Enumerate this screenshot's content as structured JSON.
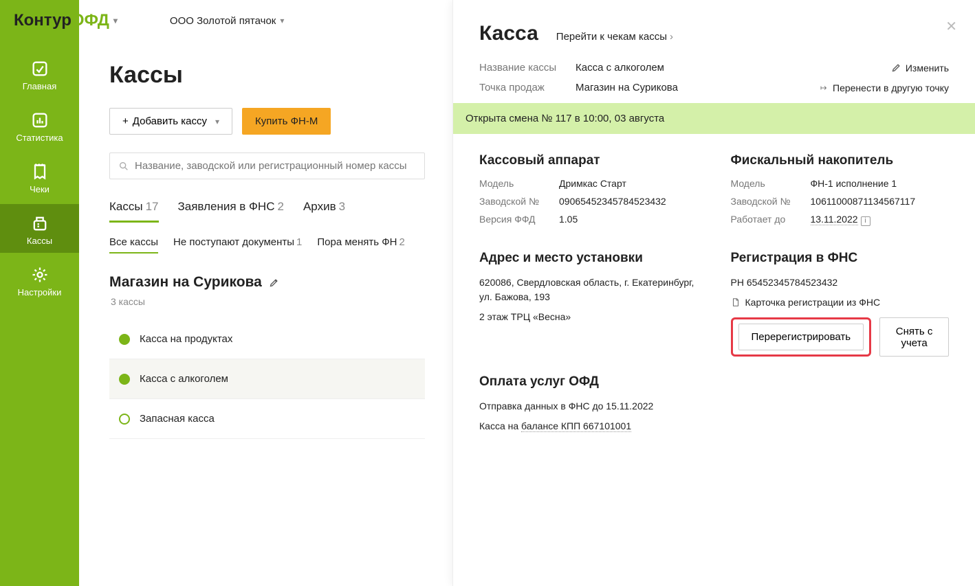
{
  "logo": {
    "part1": "Контур",
    "part2": "ОФД"
  },
  "org_name": "ООО Золотой пятачок",
  "sidebar": {
    "items": [
      {
        "label": "Главная"
      },
      {
        "label": "Статистика"
      },
      {
        "label": "Чеки"
      },
      {
        "label": "Кассы"
      },
      {
        "label": "Настройки"
      }
    ]
  },
  "main": {
    "title": "Кассы",
    "add_button": "Добавить кассу",
    "buy_button": "Купить ФН-М",
    "search_placeholder": "Название, заводской или регистрационный номер кассы",
    "tabs": [
      {
        "label": "Кассы",
        "count": "17"
      },
      {
        "label": "Заявления в ФНС",
        "count": "2"
      },
      {
        "label": "Архив",
        "count": "3"
      }
    ],
    "subtabs": [
      {
        "label": "Все кассы",
        "count": ""
      },
      {
        "label": "Не поступают документы",
        "count": "1"
      },
      {
        "label": "Пора менять ФН",
        "count": "2"
      }
    ],
    "group": {
      "name": "Магазин на Сурикова",
      "sub": "3 кассы"
    },
    "cash_list": [
      {
        "name": "Касса на продуктах",
        "solid": true
      },
      {
        "name": "Касса с алкоголем",
        "solid": true
      },
      {
        "name": "Запасная касса",
        "solid": false
      }
    ]
  },
  "detail": {
    "title": "Касса",
    "goto_cheques": "Перейти к чекам кассы",
    "name_label": "Название кассы",
    "name_value": "Касса с алкоголем",
    "edit_action": "Изменить",
    "point_label": "Точка продаж",
    "point_value": "Магазин на Сурикова",
    "move_action": "Перенести в другую точку",
    "shift_banner": "Открыта смена № 117 в 10:00, 03 августа",
    "device": {
      "title": "Кассовый аппарат",
      "model_label": "Модель",
      "model_value": "Дримкас Старт",
      "serial_label": "Заводской №",
      "serial_value": "09065452345784523432",
      "ffd_label": "Версия ФФД",
      "ffd_value": "1.05"
    },
    "fn": {
      "title": "Фискальный накопитель",
      "model_label": "Модель",
      "model_value": "ФН-1 исполнение 1",
      "serial_label": "Заводской №",
      "serial_value": "10611000871134567117",
      "until_label": "Работает до",
      "until_value": "13.11.2022"
    },
    "address": {
      "title": "Адрес и место установки",
      "line1": "620086, Свердловская область, г. Екатеринбург, ул. Бажова, 193",
      "line2": "2 этаж ТРЦ «Весна»"
    },
    "fns": {
      "title": "Регистрация в ФНС",
      "rn": "РН 65452345784523432",
      "card_link": "Карточка регистрации из ФНС",
      "rereg_button": "Перерегистрировать",
      "remove_button": "Снять с учета"
    },
    "ofd": {
      "title": "Оплата услуг ОФД",
      "send_until": "Отправка данных в ФНС  до 15.11.2022",
      "balance_prefix": "Касса на ",
      "balance_link": "балансе КПП 667101001"
    }
  }
}
